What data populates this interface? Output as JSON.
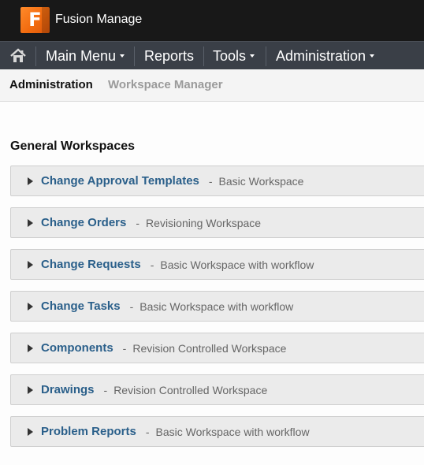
{
  "app": {
    "logo_letter": "F",
    "brand_name": "Fusion Manage",
    "accent_color": "#f26b0f"
  },
  "nav": {
    "home_icon": "home-icon",
    "items": [
      {
        "label": "Main Menu",
        "has_dropdown": true
      },
      {
        "label": "Reports",
        "has_dropdown": false
      },
      {
        "label": "Tools",
        "has_dropdown": true
      },
      {
        "label": "Administration",
        "has_dropdown": true
      }
    ]
  },
  "breadcrumb": {
    "current": "Administration",
    "section": "Workspace Manager"
  },
  "section_title": "General Workspaces",
  "workspaces": [
    {
      "name": "Change Approval Templates",
      "type": "Basic Workspace"
    },
    {
      "name": "Change Orders",
      "type": "Revisioning Workspace"
    },
    {
      "name": "Change Requests",
      "type": "Basic Workspace with workflow"
    },
    {
      "name": "Change Tasks",
      "type": "Basic Workspace with workflow"
    },
    {
      "name": "Components",
      "type": "Revision Controlled Workspace"
    },
    {
      "name": "Drawings",
      "type": "Revision Controlled Workspace"
    },
    {
      "name": "Problem Reports",
      "type": "Basic Workspace with workflow"
    }
  ],
  "separator": "-"
}
